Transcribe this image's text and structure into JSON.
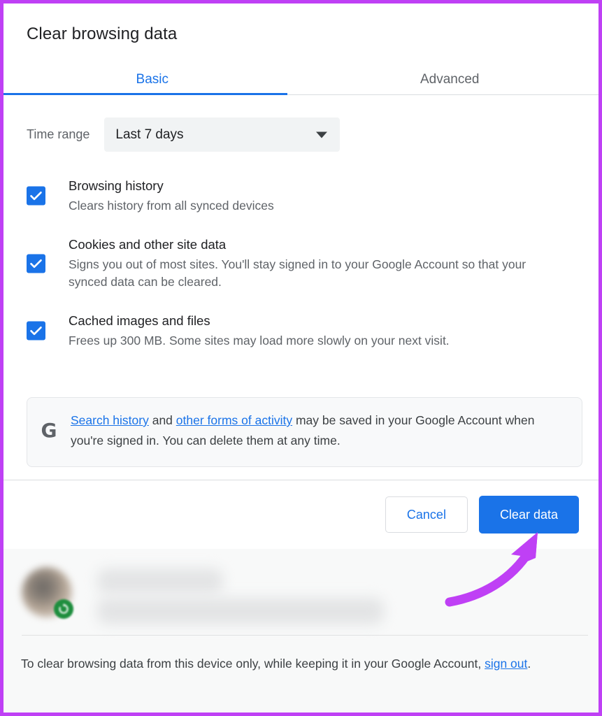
{
  "dialog": {
    "title": "Clear browsing data",
    "tabs": [
      {
        "label": "Basic",
        "active": true
      },
      {
        "label": "Advanced",
        "active": false
      }
    ],
    "time_range": {
      "label": "Time range",
      "value": "Last 7 days"
    },
    "options": [
      {
        "title": "Browsing history",
        "description": "Clears history from all synced devices",
        "checked": true
      },
      {
        "title": "Cookies and other site data",
        "description": "Signs you out of most sites. You'll stay signed in to your Google Account so that your synced data can be cleared.",
        "checked": true
      },
      {
        "title": "Cached images and files",
        "description": "Frees up 300 MB. Some sites may load more slowly on your next visit.",
        "checked": true
      }
    ],
    "infobox": {
      "icon": "google-g-icon",
      "link1": "Search history",
      "mid": " and ",
      "link2": "other forms of activity",
      "rest": " may be saved in your Google Account when you're signed in. You can delete them at any time."
    },
    "buttons": {
      "cancel": "Cancel",
      "confirm": "Clear data"
    }
  },
  "footer": {
    "note_before": "To clear browsing data from this device only, while keeping it in your Google Account, ",
    "note_link": "sign out",
    "note_after": "."
  },
  "colors": {
    "accent_blue": "#1a73e8",
    "annotation_purple": "#bf40f5",
    "sync_green": "#1e8e3e",
    "text_primary": "#202124",
    "text_secondary": "#5f6368"
  }
}
